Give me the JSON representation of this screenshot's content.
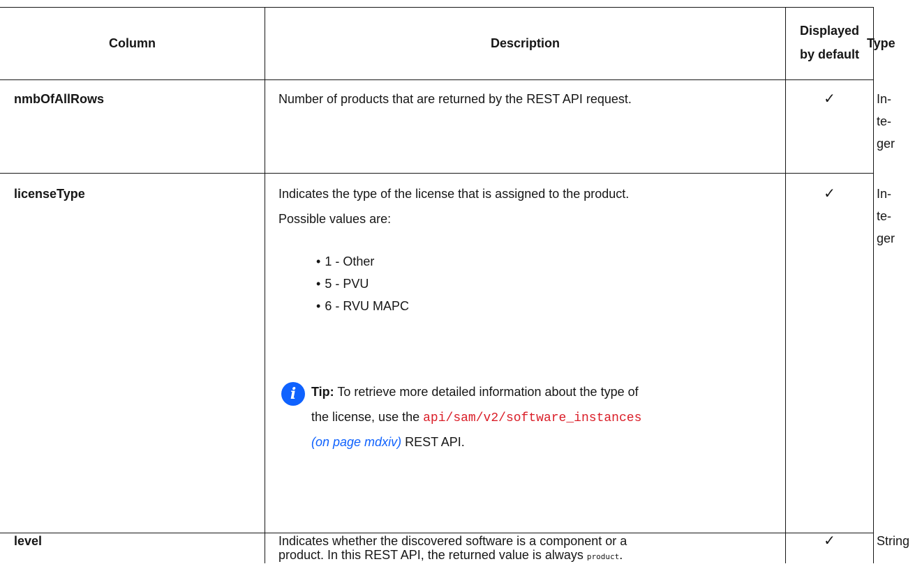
{
  "table": {
    "headers": {
      "column": "Column",
      "description": "Description",
      "displayed_line1": "Displayed",
      "displayed_line2": "by default",
      "type": "Type"
    },
    "rows": [
      {
        "column": "nmbOfAllRows",
        "description": "Number of products that are returned by the REST API request.",
        "displayed": "✓",
        "type_lines": [
          "In-",
          "te-",
          "ger"
        ]
      },
      {
        "column": "licenseType",
        "description_line1": "Indicates the type of the license that is assigned to the product.",
        "description_line2": "Possible values are:",
        "values": [
          "1 - Other",
          "5 - PVU",
          "6 - RVU MAPC"
        ],
        "tip": {
          "icon": "info-icon",
          "icon_glyph": "i",
          "label": "Tip:",
          "text_line1": "To retrieve more detailed information about the type of",
          "text_line2_prefix": "the license, use the",
          "api_path": "api/sam/v2/software_instances",
          "link_text": "(on page mdxiv)",
          "text_suffix": "REST API."
        },
        "displayed": "✓",
        "type_lines": [
          "In-",
          "te-",
          "ger"
        ]
      },
      {
        "column": "level",
        "description_line1": "Indicates whether the discovered software is a component or a",
        "description_line2_prefix": "product. In this REST API, the returned value is always",
        "description_code": "product",
        "description_line2_suffix": ".",
        "displayed": "✓",
        "type": "String"
      }
    ]
  },
  "colors": {
    "text": "#161616",
    "code": "#da1e28",
    "link": "#0f62fe",
    "tip_icon": "#0f62fe"
  }
}
